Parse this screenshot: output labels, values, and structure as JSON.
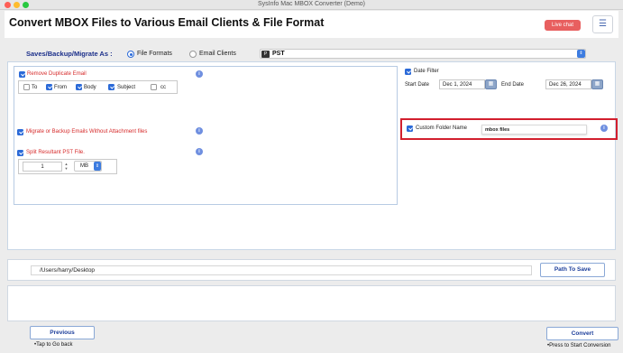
{
  "window": {
    "title": "SysInfo Mac MBOX Converter (Demo)"
  },
  "header": {
    "title": "Convert MBOX Files to Various Email Clients & File Format",
    "live_chat": "Live chat",
    "menu_icon": "hamburger-icon"
  },
  "save_as": {
    "label": "Saves/Backup/Migrate As :",
    "option_file_formats": "File Formats",
    "option_email_clients": "Email Clients",
    "selected": "File Formats",
    "format_icon": "document-icon",
    "format_value": "PST"
  },
  "options": {
    "remove_duplicate": {
      "label": "Remove Duplicate Email",
      "checked": true
    },
    "criteria": [
      {
        "label": "To",
        "checked": false
      },
      {
        "label": "From",
        "checked": true
      },
      {
        "label": "Body",
        "checked": true
      },
      {
        "label": "Subject",
        "checked": true
      },
      {
        "label": "cc",
        "checked": false
      }
    ],
    "migrate_without_attachments": {
      "label": "Migrate or Backup Emails Without Attachment files",
      "checked": true
    },
    "split_pst": {
      "label": "Split Resultant PST File.",
      "checked": true,
      "value": "1",
      "unit": "MB"
    }
  },
  "date_filter": {
    "label": "Date Filter",
    "checked": true,
    "start_label": "Start Date",
    "start_value": "Dec 1, 2024",
    "end_label": "End Date",
    "end_value": "Dec 26, 2024"
  },
  "custom_folder": {
    "label": "Custom Folder Name",
    "checked": true,
    "value": "mbox files"
  },
  "path": {
    "value": "/Users/harry/Desktop",
    "button": "Path To Save"
  },
  "footer": {
    "previous": "Previous",
    "previous_note": "•Tap to Go back",
    "convert": "Convert",
    "convert_note": "•Press to Start Conversion"
  },
  "colors": {
    "accent": "#2b6ad8",
    "highlight": "#d21f2e",
    "warning_text": "#d62b2b",
    "live_chat": "#e85f5f"
  }
}
